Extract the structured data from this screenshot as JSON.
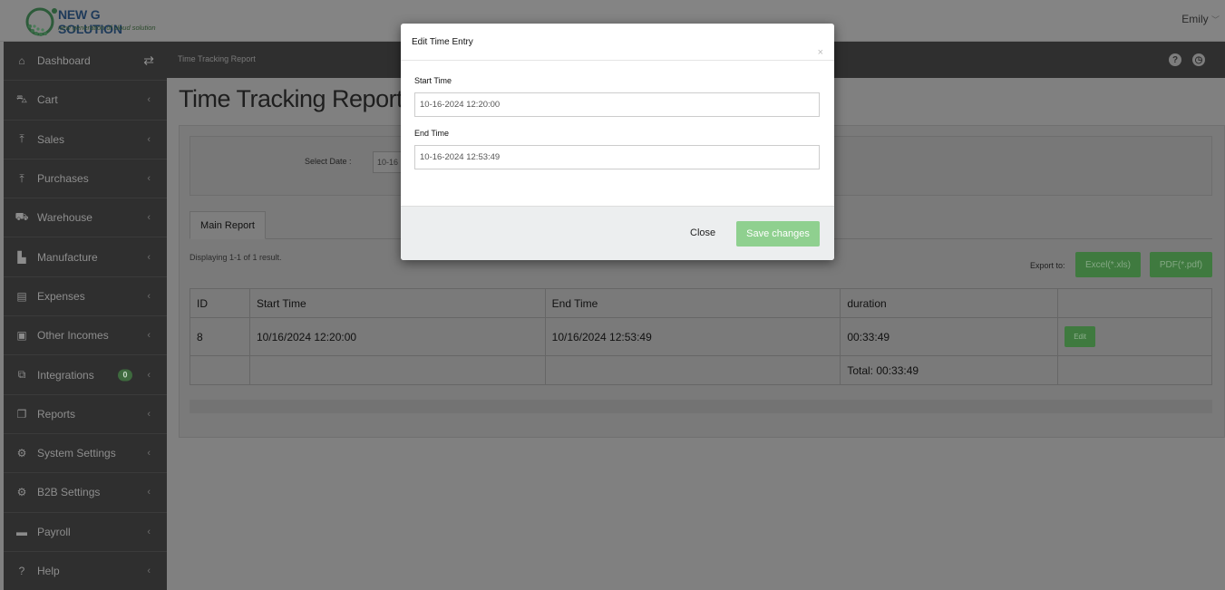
{
  "app": {
    "logo_title": "NEW G SOLUTION",
    "logo_subtitle": "new generation of cloud solution",
    "user_name": "Emily",
    "user_chevron": "﹀"
  },
  "sidebar": {
    "items": [
      {
        "label": "Dashboard",
        "icon": "home-icon",
        "glyph": "⌂"
      },
      {
        "label": "Cart",
        "icon": "cart-icon",
        "glyph": "⛍"
      },
      {
        "label": "Sales",
        "icon": "upload-icon",
        "glyph": "⤒"
      },
      {
        "label": "Purchases",
        "icon": "upload-icon",
        "glyph": "⤒"
      },
      {
        "label": "Warehouse",
        "icon": "truck-icon",
        "glyph": "⛟"
      },
      {
        "label": "Manufacture",
        "icon": "factory-icon",
        "glyph": "▙"
      },
      {
        "label": "Expenses",
        "icon": "file-icon",
        "glyph": "▤"
      },
      {
        "label": "Other Incomes",
        "icon": "money-icon",
        "glyph": "▣"
      },
      {
        "label": "Integrations",
        "icon": "devices-icon",
        "glyph": "⧉",
        "badge": "0"
      },
      {
        "label": "Reports",
        "icon": "copy-icon",
        "glyph": "❐"
      },
      {
        "label": "System Settings",
        "icon": "cogs-icon",
        "glyph": "⚙"
      },
      {
        "label": "B2B Settings",
        "icon": "cogs-icon",
        "glyph": "⚙"
      },
      {
        "label": "Payroll",
        "icon": "wallet-icon",
        "glyph": "▬"
      },
      {
        "label": "Help",
        "icon": "help-circle-icon",
        "glyph": "?"
      }
    ],
    "chevron": "‹",
    "swap_glyph": "⇄"
  },
  "breadcrumb": {
    "text": "Time Tracking Report",
    "help_glyph": "?",
    "clock_glyph": "◷"
  },
  "main": {
    "title": "Time Tracking Report -",
    "select_date_label": "Select Date :",
    "select_date_value": "10-16",
    "tab_label": "Main Report",
    "displaying": "Displaying 1-1 of 1 result.",
    "export_label": "Export to:",
    "excel_label": "Excel(*.xls)",
    "pdf_label": "PDF(*.pdf)"
  },
  "table": {
    "headers": [
      "ID",
      "Start Time",
      "End Time",
      "duration",
      ""
    ],
    "rows": [
      {
        "id": "8",
        "start": "10/16/2024 12:20:00",
        "end": "10/16/2024 12:53:49",
        "duration": "00:33:49",
        "action": "Edit"
      }
    ],
    "total": "Total: 00:33:49"
  },
  "modal": {
    "title": "Edit Time Entry",
    "close_x": "×",
    "start_label": "Start Time",
    "start_value": "10-16-2024 12:20:00",
    "end_label": "End Time",
    "end_value": "10-16-2024 12:53:49",
    "close_button": "Close",
    "save_button": "Save changes"
  },
  "colors": {
    "sidebar_bg": "#2f2f2f",
    "overlay": "#808080",
    "primary_green": "#8fd08f"
  }
}
